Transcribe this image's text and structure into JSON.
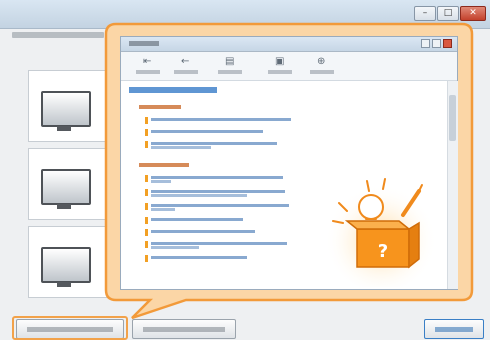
{
  "window": {
    "title": "",
    "subtitle": "",
    "controls": [
      "minimize-icon",
      "maximize-icon",
      "close-icon"
    ]
  },
  "options": [
    {
      "icon": "monitor-icon",
      "label": ""
    },
    {
      "icon": "monitor-icon",
      "label": ""
    },
    {
      "icon": "monitor-icon",
      "label": ""
    }
  ],
  "buttons": {
    "primary": "",
    "secondary": "",
    "next": ""
  },
  "help_window": {
    "title": "",
    "toolbar": [
      {
        "icon": "hide-icon",
        "label": ""
      },
      {
        "icon": "back-icon",
        "label": ""
      },
      {
        "icon": "print-icon",
        "label": ""
      },
      {
        "icon": "options-icon",
        "label": ""
      },
      {
        "icon": "web-help-icon",
        "label": ""
      }
    ],
    "heading": "",
    "sections": [
      {
        "title": "",
        "items": 3
      },
      {
        "title": "",
        "items": 7
      }
    ]
  },
  "illustration": {
    "icon": "lightbulb-box-icon",
    "mark": "?"
  },
  "colors": {
    "accent_orange": "#f2a24a",
    "link_blue": "#2a73c4",
    "close_red": "#c3412c"
  }
}
